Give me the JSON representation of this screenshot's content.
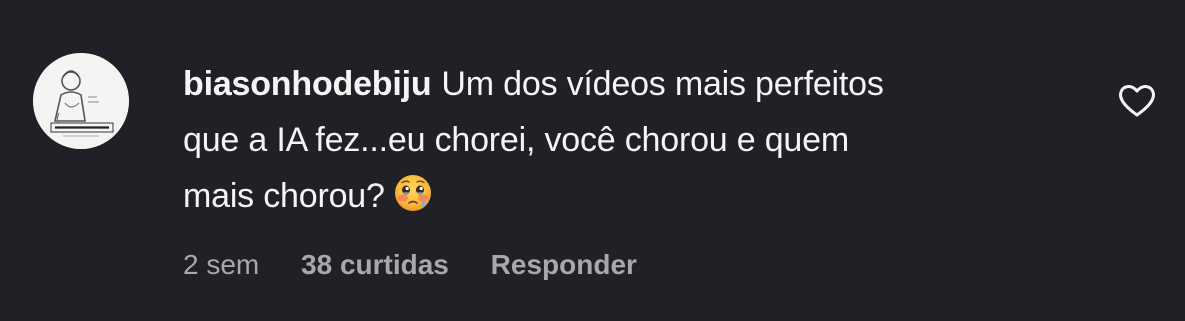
{
  "comment": {
    "username": "biasonhodebiju",
    "text_line1": "Um dos vídeos mais perfeitos",
    "text_line2": "que a IA fez...eu chorei, você chorou e quem",
    "text_line3": "mais chorou?",
    "emoji": "face-holding-back-tears-emoji",
    "time": "2 sem",
    "likes": "38 curtidas",
    "reply_label": "Responder",
    "avatar_icon": "profile-avatar",
    "like_icon": "heart-outline-icon"
  },
  "colors": {
    "background": "#202126",
    "text": "#f5f5f5",
    "meta": "#a8a8a8"
  }
}
